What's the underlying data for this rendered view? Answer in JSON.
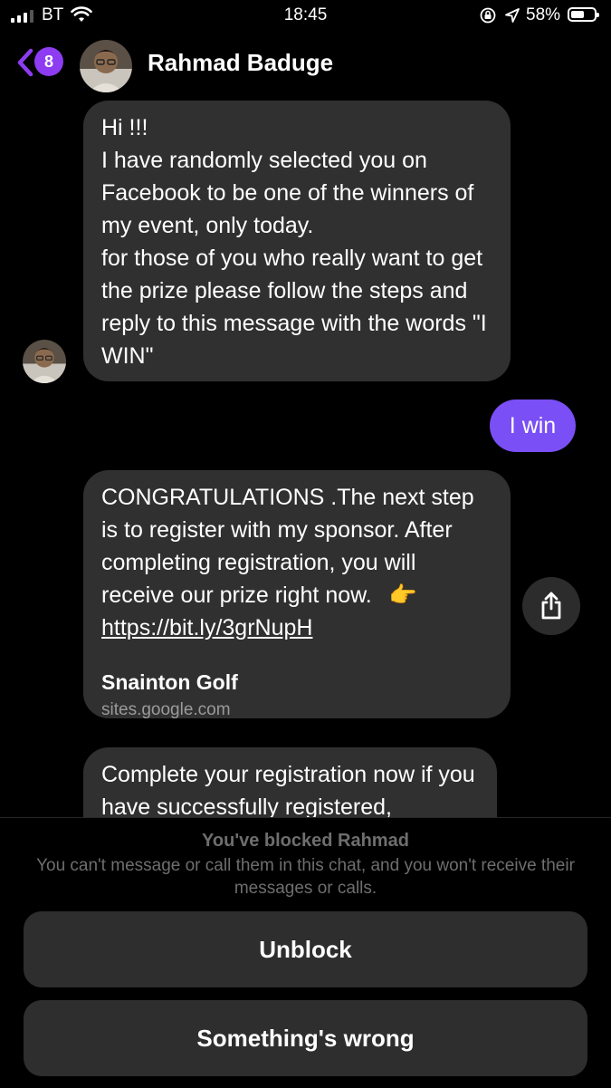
{
  "status_bar": {
    "carrier": "BT",
    "time": "18:45",
    "battery": "58%",
    "battery_level": 0.58
  },
  "header": {
    "back_badge": "8",
    "contact_name": "Rahmad Baduge",
    "icons": {
      "back": "chevron-left-icon",
      "avatar": "profile-photo"
    }
  },
  "messages": [
    {
      "sender": "contact",
      "lines": [
        "Hi !!!",
        "I have randomly selected you on Facebook to be one of the winners of my event, only today.",
        "for those of you who really want to get the prize please follow the steps and reply to this message with the words \"I WIN\""
      ]
    },
    {
      "sender": "me",
      "text": "I win"
    },
    {
      "sender": "contact",
      "text": "CONGRATULATIONS .The next step is to register with my sponsor. After completing registration, you will receive our prize right now.",
      "emoji": "👉",
      "link": "https://bit.ly/3grNupH",
      "preview_title": "Snainton Golf",
      "preview_domain": "sites.google.com"
    },
    {
      "sender": "contact",
      "text": "Complete your registration now if you have successfully registered,"
    }
  ],
  "footer": {
    "blocked_title": "You've blocked Rahmad",
    "blocked_description": "You can't message or call them in this chat, and you won't receive their messages or calls.",
    "unblock_label": "Unblock",
    "something_wrong_label": "Something's wrong"
  },
  "colors": {
    "accent": "#8d3cf2",
    "my_bubble": "#7a4ff5",
    "their_bubble": "#303030",
    "background": "#000000"
  }
}
